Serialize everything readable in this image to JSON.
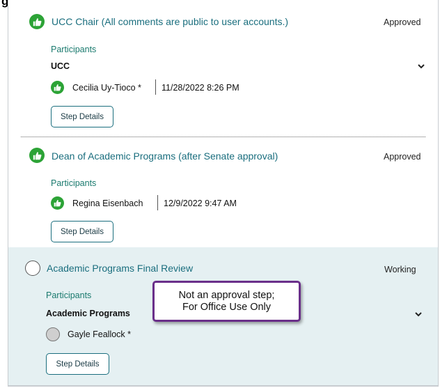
{
  "header_fragment": "gnatures",
  "steps": [
    {
      "title": "UCC Chair (All comments are public to user accounts.)",
      "status": "Approved",
      "participants_label": "Participants",
      "group": "UCC",
      "participant_name": "Cecilia Uy-Tioco *",
      "timestamp": "11/28/2022 8:26 PM",
      "details_label": "Step Details"
    },
    {
      "title": "Dean of Academic Programs (after Senate approval)",
      "status": "Approved",
      "participants_label": "Participants",
      "participant_name": "Regina Eisenbach",
      "timestamp": "12/9/2022 9:47 AM",
      "details_label": "Step Details"
    },
    {
      "title": "Academic Programs Final Review",
      "status": "Working",
      "participants_label": "Participants",
      "group": "Academic Programs",
      "participant_name": "Gayle Feallock *",
      "details_label": "Step Details"
    }
  ],
  "callout": {
    "line1": "Not an approval step;",
    "line2": "For Office Use Only"
  },
  "colors": {
    "approved": "#2ca336",
    "link_teal": "#1a6e7e",
    "active_bg": "#e5f0f2",
    "callout_border": "#6a2f8a"
  },
  "icons": {
    "approved": "thumbs-up-icon",
    "open": "open-circle-icon",
    "pending": "pending-circle-icon",
    "expand": "chevron-down-icon"
  }
}
